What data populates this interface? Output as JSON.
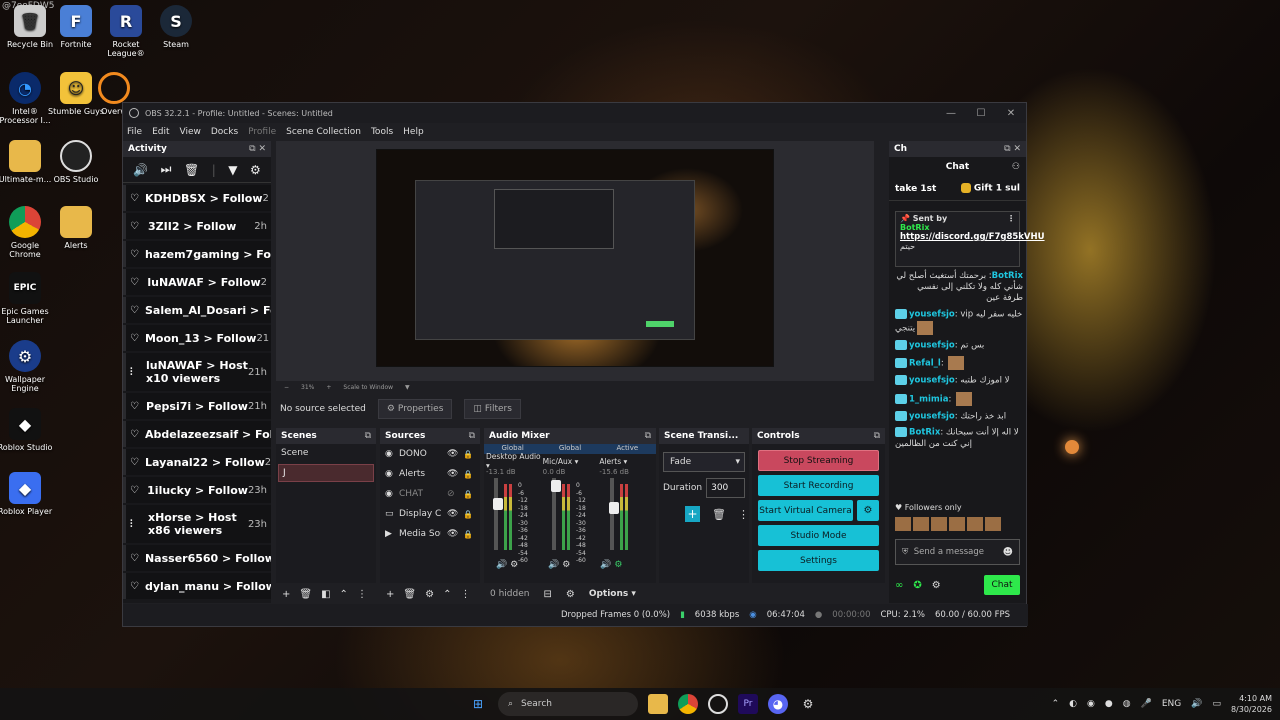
{
  "watermark": "@7ooFDW5",
  "desktop_icons": [
    {
      "label": "Recycle Bin",
      "icon": "recycle-bin-icon"
    },
    {
      "label": "Fortnite",
      "icon": "fortnite-icon"
    },
    {
      "label": "Rocket League®",
      "icon": "rocket-league-icon"
    },
    {
      "label": "Steam",
      "icon": "steam-icon"
    },
    {
      "label": "Intel® Processor I...",
      "icon": "intel-icon"
    },
    {
      "label": "Stumble Guys",
      "icon": "stumble-guys-icon"
    },
    {
      "label": "Overw",
      "icon": "overwatch-icon"
    },
    {
      "label": "Ultimate-m...",
      "icon": "folder-icon"
    },
    {
      "label": "OBS Studio",
      "icon": "obs-icon"
    },
    {
      "label": "Google Chrome",
      "icon": "chrome-icon"
    },
    {
      "label": "Alerts",
      "icon": "folder-icon"
    },
    {
      "label": "Epic Games Launcher",
      "icon": "epic-icon"
    },
    {
      "label": "Wallpaper Engine",
      "icon": "wallpaper-engine-icon"
    },
    {
      "label": "Roblox Studio",
      "icon": "roblox-studio-icon"
    },
    {
      "label": "Roblox Player",
      "icon": "roblox-player-icon"
    }
  ],
  "obs": {
    "title": "OBS 32.2.1 - Profile: Untitled - Scenes: Untitled",
    "menu": [
      "File",
      "Edit",
      "View",
      "Docks",
      "Profile",
      "Scene Collection",
      "Tools",
      "Help"
    ],
    "activity": {
      "title": "Activity",
      "items": [
        {
          "text": "KDHDBSX > Follow",
          "time": "2"
        },
        {
          "text": "3ZII2 > Follow",
          "time": "2h"
        },
        {
          "text": "hazem7gaming > Follo",
          "time": ""
        },
        {
          "text": "luNAWAF > Follow",
          "time": "2"
        },
        {
          "text": "Salem_Al_Dosari > Fo",
          "time": ""
        },
        {
          "text": "Moon_13 > Follow",
          "time": "21"
        },
        {
          "text": "luNAWAF > Host",
          "sub": "x10 viewers",
          "time": "21h"
        },
        {
          "text": "Pepsi7i > Follow",
          "time": "21h"
        },
        {
          "text": "Abdelazeezsaif > Follo",
          "time": ""
        },
        {
          "text": "Layanal22 > Follow",
          "time": "2"
        },
        {
          "text": "1ilucky > Follow",
          "time": "23h"
        },
        {
          "text": "xHorse > Host",
          "sub": "x86 viewers",
          "time": "23h"
        },
        {
          "text": "Nasser6560 > Follow",
          "time": ""
        },
        {
          "text": "dylan_manu > Follow",
          "time": "2"
        }
      ]
    },
    "zoom": "31%",
    "scale_mode": "Scale to Window",
    "source_status": "No source selected",
    "properties_label": "Properties",
    "filters_label": "Filters",
    "scenes": {
      "title": "Scenes",
      "items": [
        "Scene"
      ],
      "editing": "J"
    },
    "sources": {
      "title": "Sources",
      "items": [
        {
          "name": "DONO",
          "icon": "browser-icon"
        },
        {
          "name": "Alerts",
          "icon": "browser-icon"
        },
        {
          "name": "CHAT",
          "icon": "browser-icon",
          "hidden": true
        },
        {
          "name": "Display Ca",
          "icon": "display-icon"
        },
        {
          "name": "Media Sou",
          "icon": "play-icon"
        }
      ]
    },
    "mixer": {
      "title": "Audio Mixer",
      "heads": [
        "Global",
        "Global",
        "Active"
      ],
      "channels": [
        {
          "name": "Desktop Audio",
          "db": "-13.1 dB"
        },
        {
          "name": "Mic/Aux",
          "db": "0.0 dB"
        },
        {
          "name": "Alerts",
          "db": "-15.6 dB"
        }
      ],
      "scale": [
        "0",
        "-6",
        "-12",
        "-18",
        "-24",
        "-30",
        "-36",
        "-42",
        "-48",
        "-54",
        "-60"
      ],
      "hidden": "0 hidden",
      "options": "Options"
    },
    "transitions": {
      "title": "Scene Transi...",
      "selected": "Fade",
      "duration_label": "Duration",
      "duration": "300"
    },
    "controls": {
      "title": "Controls",
      "stop_streaming": "Stop Streaming",
      "start_recording": "Start Recording",
      "start_virtual_camera": "Start Virtual Camera",
      "studio_mode": "Studio Mode",
      "settings": "Settings"
    },
    "status": {
      "dropped": "Dropped Frames 0 (0.0%)",
      "kbps": "6038 kbps",
      "live_time": "06:47:04",
      "rec_time": "00:00:00",
      "cpu": "CPU: 2.1%",
      "fps": "60.00 / 60.00 FPS"
    }
  },
  "chat": {
    "dock_title": "Ch",
    "title": "Chat",
    "gift_left": "take 1st",
    "gift_right": "Gift 1 sul",
    "pinned": {
      "sent_by": "Sent by",
      "user": "BotRix",
      "link": "https://discord.gg/F7g85kVHU",
      "tail": "حيتم"
    },
    "messages": [
      {
        "user": "BotRix",
        "text": "برحمتك أستغيث أصلح لي شأني كله ولا تكلني إلى نفسي طرفة عين"
      },
      {
        "user": "yousefsjo",
        "text": "vip خليه سفر ليه يتنجي"
      },
      {
        "user": "yousefsjo",
        "text": "بس تم"
      },
      {
        "user": "Refal_l",
        "text": ""
      },
      {
        "user": "yousefsjo",
        "text": "لا اموزك طتبه"
      },
      {
        "user": "1_mimia",
        "text": ""
      },
      {
        "user": "yousefsjo",
        "text": "ابد خذ راحتك"
      },
      {
        "user": "BotRix",
        "text": "لا اله إلا أنت سبحانك إني كنت من الظالمين"
      }
    ],
    "followers_only": "Followers only",
    "send_placeholder": "Send a message",
    "chat_button": "Chat"
  },
  "taskbar": {
    "search": "Search",
    "lang": "ENG",
    "time": "4:10 AM",
    "date": "8/30/2026"
  }
}
